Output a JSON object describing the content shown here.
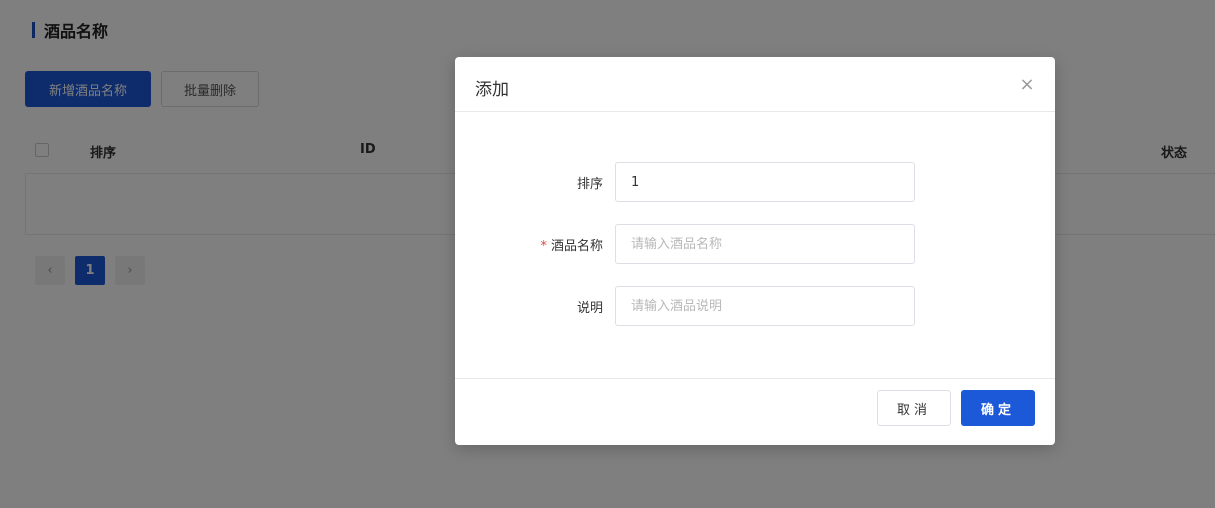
{
  "page": {
    "title": "酒品名称",
    "add_button": "新增酒品名称",
    "batch_delete_button": "批量删除"
  },
  "table": {
    "columns": [
      "排序",
      "ID",
      "状态"
    ]
  },
  "pagination": {
    "prev_icon": "chevron-left-icon",
    "current_page": "1",
    "next_icon": "chevron-right-icon"
  },
  "modal": {
    "title": "添加",
    "close_icon": "close-icon",
    "fields": [
      {
        "label": "排序",
        "value": "1",
        "placeholder": "",
        "required": false
      },
      {
        "label": "酒品名称",
        "value": "",
        "placeholder": "请输入酒品名称",
        "required": true
      },
      {
        "label": "说明",
        "value": "",
        "placeholder": "请输入酒品说明",
        "required": false
      }
    ],
    "cancel_label": "取消",
    "ok_label": "确定"
  },
  "colors": {
    "primary": "#1c59d8",
    "required": "#e8453c",
    "overlay": "rgba(0,0,0,0.5)"
  }
}
